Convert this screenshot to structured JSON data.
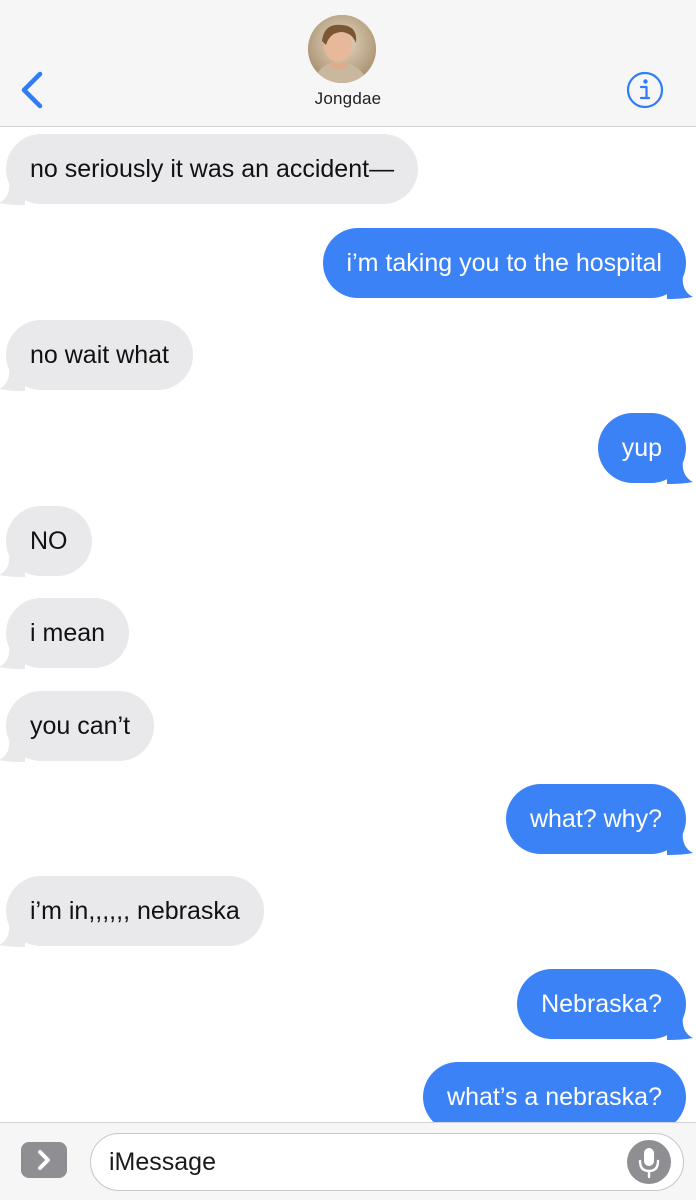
{
  "header": {
    "contact_name": "Jongdae",
    "back_icon": "chevron-left-icon",
    "info_icon": "info-icon"
  },
  "colors": {
    "incoming_bubble": "#e9e9eb",
    "outgoing_bubble": "#3b82f6",
    "accent": "#2f7cf6"
  },
  "messages": [
    {
      "direction": "incoming",
      "text": "no seriously it was an accident—"
    },
    {
      "direction": "outgoing",
      "text": "i’m taking you to the hospital"
    },
    {
      "direction": "incoming",
      "text": "no wait what"
    },
    {
      "direction": "outgoing",
      "text": "yup"
    },
    {
      "direction": "incoming",
      "text": "NO"
    },
    {
      "direction": "incoming",
      "text": "i mean"
    },
    {
      "direction": "incoming",
      "text": "you can’t"
    },
    {
      "direction": "outgoing",
      "text": "what? why?"
    },
    {
      "direction": "incoming",
      "text": "i’m in,,,,,, nebraska"
    },
    {
      "direction": "outgoing",
      "text": "Nebraska?"
    },
    {
      "direction": "outgoing",
      "text": "what’s a nebraska?"
    }
  ],
  "input": {
    "placeholder": "iMessage",
    "apps_icon": "chevron-right-icon",
    "mic_icon": "microphone-icon"
  }
}
